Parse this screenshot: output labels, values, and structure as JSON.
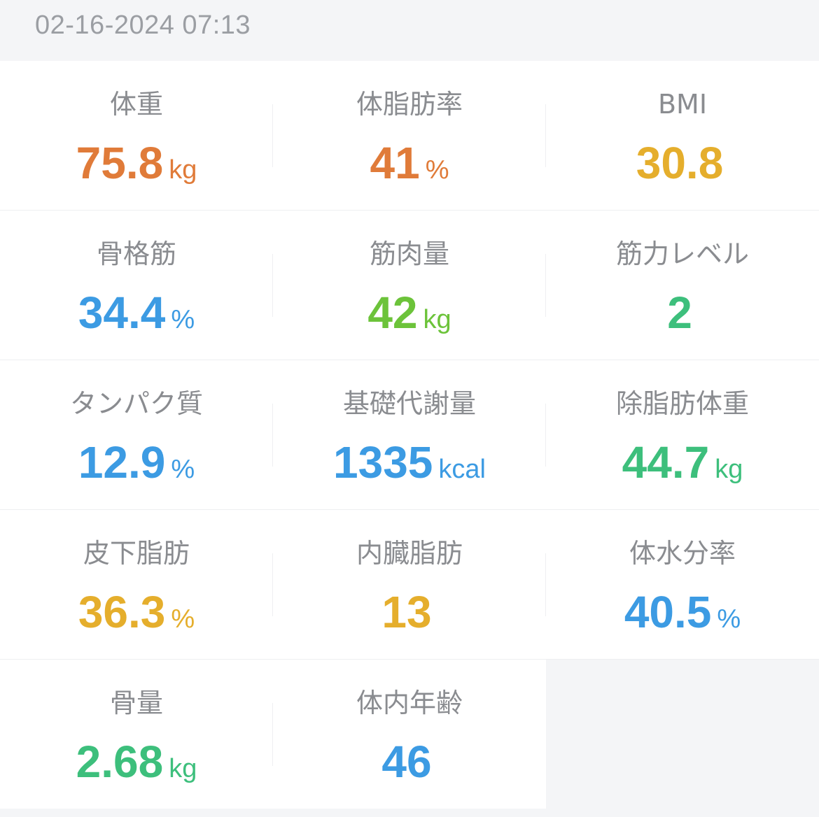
{
  "header": {
    "date": "02-16-2024 07:13"
  },
  "colors": {
    "orange": "#e07b39",
    "yellow": "#e5ae2c",
    "blue": "#3c9be3",
    "lime": "#6cc33a",
    "green": "#3dbf7c"
  },
  "metrics": [
    {
      "label": "体重",
      "value": "75.8",
      "unit": "kg",
      "color": "#e07b39"
    },
    {
      "label": "体脂肪率",
      "value": "41",
      "unit": "%",
      "color": "#e07b39"
    },
    {
      "label": "BMI",
      "value": "30.8",
      "unit": "",
      "color": "#e5ae2c"
    },
    {
      "label": "骨格筋",
      "value": "34.4",
      "unit": "%",
      "color": "#3c9be3"
    },
    {
      "label": "筋肉量",
      "value": "42",
      "unit": "kg",
      "color": "#6cc33a"
    },
    {
      "label": "筋力レベル",
      "value": "2",
      "unit": "",
      "color": "#3dbf7c"
    },
    {
      "label": "タンパク質",
      "value": "12.9",
      "unit": "%",
      "color": "#3c9be3"
    },
    {
      "label": "基礎代謝量",
      "value": "1335",
      "unit": "kcal",
      "color": "#3c9be3"
    },
    {
      "label": "除脂肪体重",
      "value": "44.7",
      "unit": "kg",
      "color": "#3dbf7c"
    },
    {
      "label": "皮下脂肪",
      "value": "36.3",
      "unit": "%",
      "color": "#e5ae2c"
    },
    {
      "label": "内臓脂肪",
      "value": "13",
      "unit": "",
      "color": "#e5ae2c"
    },
    {
      "label": "体水分率",
      "value": "40.5",
      "unit": "%",
      "color": "#3c9be3"
    },
    {
      "label": "骨量",
      "value": "2.68",
      "unit": "kg",
      "color": "#3dbf7c"
    },
    {
      "label": "体内年齢",
      "value": "46",
      "unit": "",
      "color": "#3c9be3"
    }
  ]
}
